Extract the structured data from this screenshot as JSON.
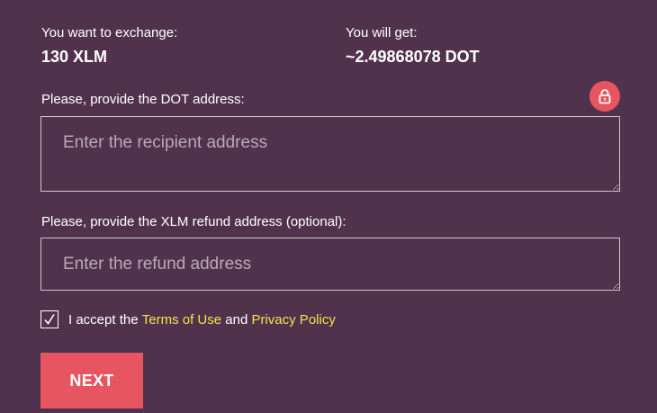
{
  "summary": {
    "exchange_label": "You want to exchange:",
    "exchange_value": "130 XLM",
    "get_label": "You will get:",
    "get_value": "~2.49868078 DOT"
  },
  "recipient": {
    "label": "Please, provide the DOT address:",
    "placeholder": "Enter the recipient address",
    "value": ""
  },
  "refund": {
    "label": "Please, provide the XLM refund address (optional):",
    "placeholder": "Enter the refund address",
    "value": ""
  },
  "terms": {
    "checked": true,
    "prefix": "I accept the",
    "terms_link": "Terms of Use",
    "conjunction": "and",
    "privacy_link": "Privacy Policy"
  },
  "next_button": {
    "label": "NEXT"
  },
  "icons": {
    "lock": "lock-icon",
    "check": "checkmark-icon"
  },
  "colors": {
    "background": "#51324d",
    "accent": "#e65560",
    "link": "#f4e24c",
    "border": "#cfc3cd"
  }
}
